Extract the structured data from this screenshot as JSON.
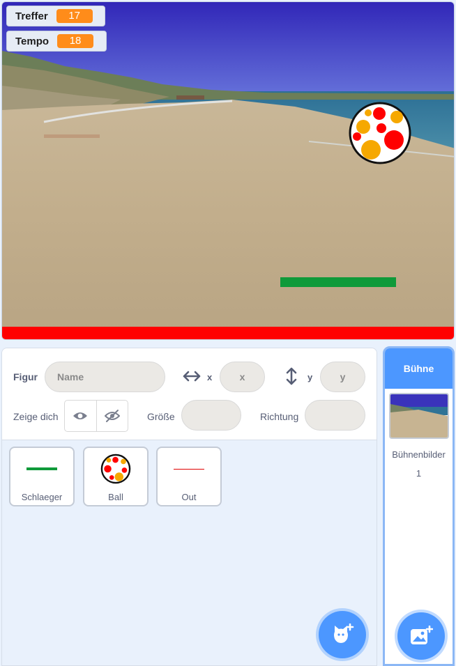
{
  "monitors": [
    {
      "label": "Treffer",
      "value": "17"
    },
    {
      "label": "Tempo",
      "value": "18"
    }
  ],
  "sprite_info": {
    "figur_label": "Figur",
    "name_placeholder": "Name",
    "x_label": "x",
    "x_placeholder": "x",
    "y_label": "y",
    "y_placeholder": "y",
    "show_label": "Zeige dich",
    "size_label": "Größe",
    "direction_label": "Richtung"
  },
  "sprites": [
    {
      "name": "Schlaeger"
    },
    {
      "name": "Ball"
    },
    {
      "name": "Out"
    }
  ],
  "stage_panel": {
    "title": "Bühne",
    "backdrops_label": "Bühnenbilder",
    "backdrops_count": "1"
  },
  "colors": {
    "accent": "#4c97ff",
    "monitor_value": "#ff8c1a",
    "paddle": "#0f9a3a",
    "floor": "#ff0000"
  },
  "icons": {
    "show": "eye-icon",
    "hide": "eye-slash-icon",
    "add_sprite": "cat-plus-icon",
    "add_backdrop": "image-plus-icon"
  }
}
